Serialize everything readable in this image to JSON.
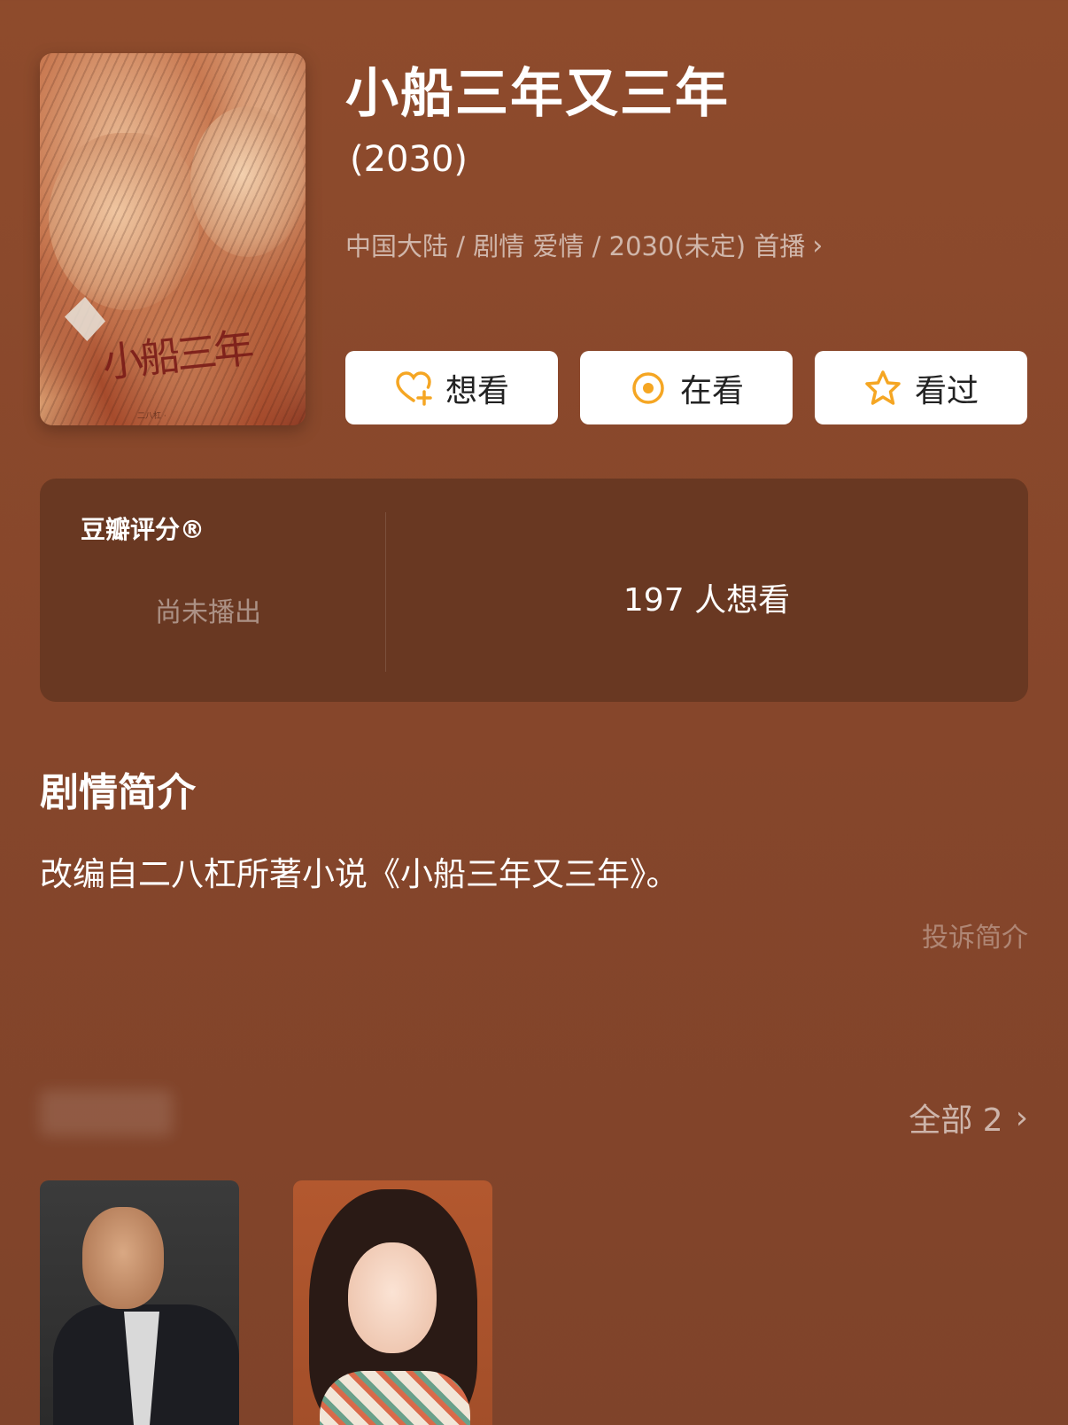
{
  "movie": {
    "title": "小船三年又三年",
    "year": "(2030)",
    "meta": "中国大陆 / 剧情 爱情 / 2030(未定) 首播",
    "meta_chevron": "›",
    "poster": {
      "title_art": "小船三年",
      "credits": "二八杠 ·  "
    }
  },
  "actions": {
    "want": "想看",
    "watching": "在看",
    "watched": "看过"
  },
  "rating": {
    "title": "豆瓣评分®",
    "status": "尚未播出",
    "wish_count": "197 人想看"
  },
  "synopsis": {
    "heading": "剧情简介",
    "text": "改编自二八杠所著小说《小船三年又三年》。",
    "report": "投诉简介"
  },
  "cast": {
    "all_link": "全部 2",
    "chevron": "›"
  },
  "colors": {
    "background": "#8a482b",
    "card": "#693822",
    "accent_icon": "#f5a623"
  }
}
